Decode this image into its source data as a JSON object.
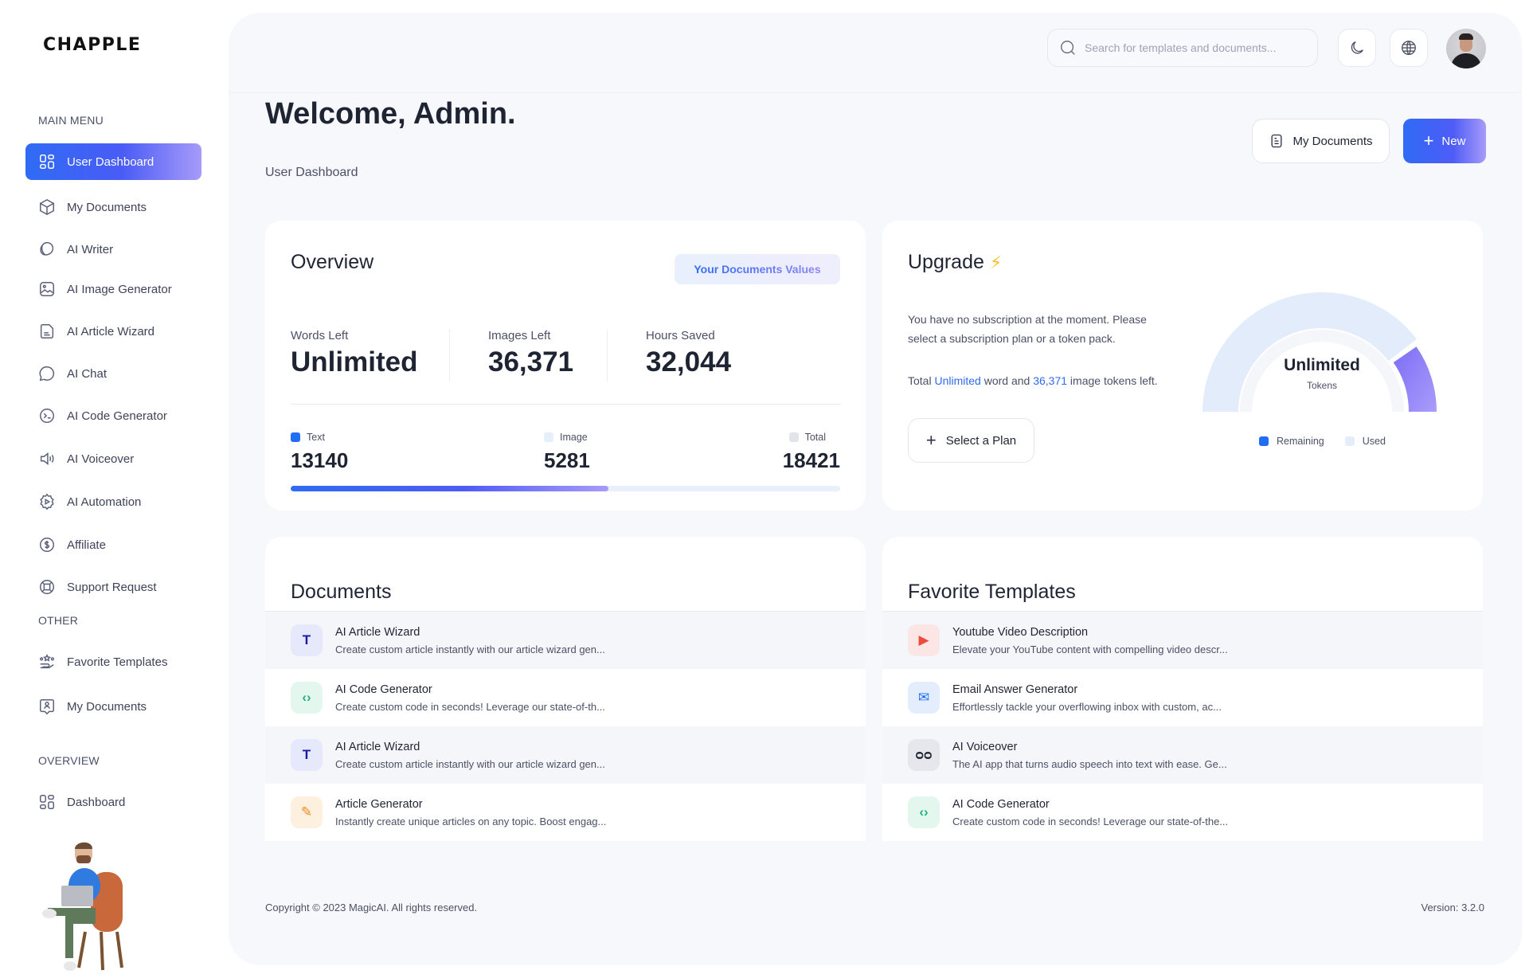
{
  "brand": {
    "logo": "CHAPPLE"
  },
  "sidebar": {
    "sections": [
      {
        "label": "MAIN MENU"
      },
      {
        "label": "OTHER"
      },
      {
        "label": "OVERVIEW"
      }
    ],
    "items": [
      {
        "label": "User Dashboard",
        "icon": "grid-icon",
        "active": true
      },
      {
        "label": "My Documents",
        "icon": "box-icon"
      },
      {
        "label": "AI Writer",
        "icon": "writer-icon"
      },
      {
        "label": "AI Image Generator",
        "icon": "image-icon"
      },
      {
        "label": "AI Article Wizard",
        "icon": "article-icon"
      },
      {
        "label": "AI Chat",
        "icon": "chat-icon"
      },
      {
        "label": "AI Code Generator",
        "icon": "terminal-icon"
      },
      {
        "label": "AI Voiceover",
        "icon": "speaker-icon"
      },
      {
        "label": "AI Automation",
        "icon": "gear-play-icon"
      },
      {
        "label": "Affiliate",
        "icon": "dollar-icon"
      },
      {
        "label": "Support Request",
        "icon": "lifebuoy-icon"
      },
      {
        "label": "Favorite Templates",
        "icon": "hand-star-icon"
      },
      {
        "label": "My Documents",
        "icon": "user-doc-icon"
      },
      {
        "label": "Dashboard",
        "icon": "grid-icon"
      }
    ]
  },
  "topbar": {
    "search_placeholder": "Search for templates and documents...",
    "search_value": "",
    "theme_icon": "moon-icon",
    "language_icon": "globe-icon"
  },
  "page": {
    "title": "Welcome, Admin.",
    "subtitle": "User Dashboard",
    "my_documents_label": "My Documents",
    "new_label": "New"
  },
  "overview": {
    "title": "Overview",
    "badge": "Your Documents Values",
    "stats": [
      {
        "label": "Words Left",
        "value": "Unlimited"
      },
      {
        "label": "Images Left",
        "value": "36,371"
      },
      {
        "label": "Hours Saved",
        "value": "32,044"
      }
    ],
    "legend": [
      {
        "label": "Text",
        "value": "13140",
        "color": "#1f6ef5"
      },
      {
        "label": "Image",
        "value": "5281",
        "color": "#e6eefc"
      },
      {
        "label": "Total",
        "value": "18421",
        "color": "#e2e4ea"
      }
    ],
    "progress_percent": 57.8
  },
  "upgrade": {
    "title": "Upgrade",
    "bolt": "⚡",
    "description": "You have no subscription at the moment. Please select a subscription plan or a token pack.",
    "total_prefix": "Total",
    "total_words": "Unlimited",
    "total_mid": "word and",
    "total_images": "36,371",
    "total_suffix": "image tokens left.",
    "select_plan_label": "Select a Plan",
    "gauge": {
      "value_label": "Unlimited",
      "unit_label": "Tokens",
      "remaining_fraction": 0.8,
      "used_fraction": 0.2,
      "legend": [
        {
          "label": "Remaining",
          "color": "#1f6ef5"
        },
        {
          "label": "Used",
          "color": "#e4edfb"
        }
      ]
    }
  },
  "documents": {
    "title": "Documents",
    "items": [
      {
        "title": "AI Article Wizard",
        "desc": "Create custom article instantly with our article wizard gen...",
        "icon": "T",
        "icon_name": "text-t-icon",
        "bg": "#e6e8fb",
        "fg": "#1a1aa8"
      },
      {
        "title": "AI Code Generator",
        "desc": "Create custom code in seconds! Leverage our state-of-th...",
        "icon": "‹›",
        "icon_name": "code-bubble-icon",
        "bg": "#e3f7ef",
        "fg": "#1fb57a"
      },
      {
        "title": "AI Article Wizard",
        "desc": "Create custom article instantly with our article wizard gen...",
        "icon": "T",
        "icon_name": "text-t-icon",
        "bg": "#e6e8fb",
        "fg": "#1a1aa8"
      },
      {
        "title": "Article Generator",
        "desc": "Instantly create unique articles on any topic. Boost engag...",
        "icon": "✎",
        "icon_name": "pencil-box-icon",
        "bg": "#fdf0df",
        "fg": "#f08a1c"
      }
    ]
  },
  "favorites": {
    "title": "Favorite Templates",
    "items": [
      {
        "title": "Youtube Video Description",
        "desc": "Elevate your YouTube content with compelling video descr...",
        "icon": "▶",
        "icon_name": "youtube-icon",
        "bg": "#fbe6e5",
        "fg": "#ee4b3c"
      },
      {
        "title": "Email Answer Generator",
        "desc": "Effortlessly tackle your overflowing inbox with custom, ac...",
        "icon": "✉",
        "icon_name": "email-icon",
        "bg": "#e3edfc",
        "fg": "#1f6ef5"
      },
      {
        "title": "AI Voiceover",
        "desc": "The AI app that turns audio speech into text with ease. Ge...",
        "icon": "ᴑᴑ",
        "icon_name": "voicemail-icon",
        "bg": "#e6e7ec",
        "fg": "#1f2433"
      },
      {
        "title": "AI Code Generator",
        "desc": "Create custom code in seconds! Leverage our state-of-the...",
        "icon": "‹›",
        "icon_name": "code-bubble-icon",
        "bg": "#e3f7ef",
        "fg": "#1fb57a"
      }
    ]
  },
  "footer": {
    "copyright": "Copyright © 2023 MagicAI. All rights reserved.",
    "version": "Version: 3.2.0"
  }
}
